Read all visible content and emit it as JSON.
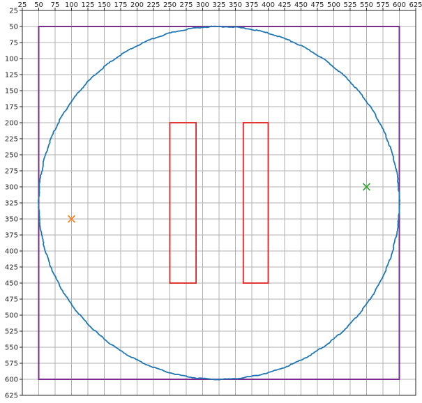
{
  "chart_data": {
    "type": "scatter",
    "title": "",
    "xlabel": "",
    "ylabel": "",
    "xlim": [
      25,
      625
    ],
    "ylim": [
      625,
      25
    ],
    "y_inverted": true,
    "x_axis_position": "top",
    "grid": true,
    "x_ticks": [
      25,
      50,
      75,
      100,
      125,
      150,
      175,
      200,
      225,
      250,
      275,
      300,
      325,
      350,
      375,
      400,
      425,
      450,
      475,
      500,
      525,
      550,
      575,
      600,
      625
    ],
    "y_ticks": [
      25,
      50,
      75,
      100,
      125,
      150,
      175,
      200,
      225,
      250,
      275,
      300,
      325,
      350,
      375,
      400,
      425,
      450,
      475,
      500,
      525,
      550,
      575,
      600,
      625
    ],
    "boundary": {
      "x": [
        50,
        600
      ],
      "y": [
        50,
        600
      ],
      "color": "#7b2d8e"
    },
    "circle": {
      "cx": 325,
      "cy": 325,
      "r": 275,
      "color": "#1f77b4"
    },
    "rectangles": [
      {
        "x": [
          250,
          290
        ],
        "y": [
          200,
          450
        ],
        "color": "#e02020"
      },
      {
        "x": [
          362,
          400
        ],
        "y": [
          200,
          450
        ],
        "color": "#e02020"
      }
    ],
    "markers": [
      {
        "x": 100,
        "y": 350,
        "symbol": "x",
        "color": "#ff7f0e"
      },
      {
        "x": 550,
        "y": 300,
        "symbol": "x",
        "color": "#2ca02c"
      }
    ]
  }
}
